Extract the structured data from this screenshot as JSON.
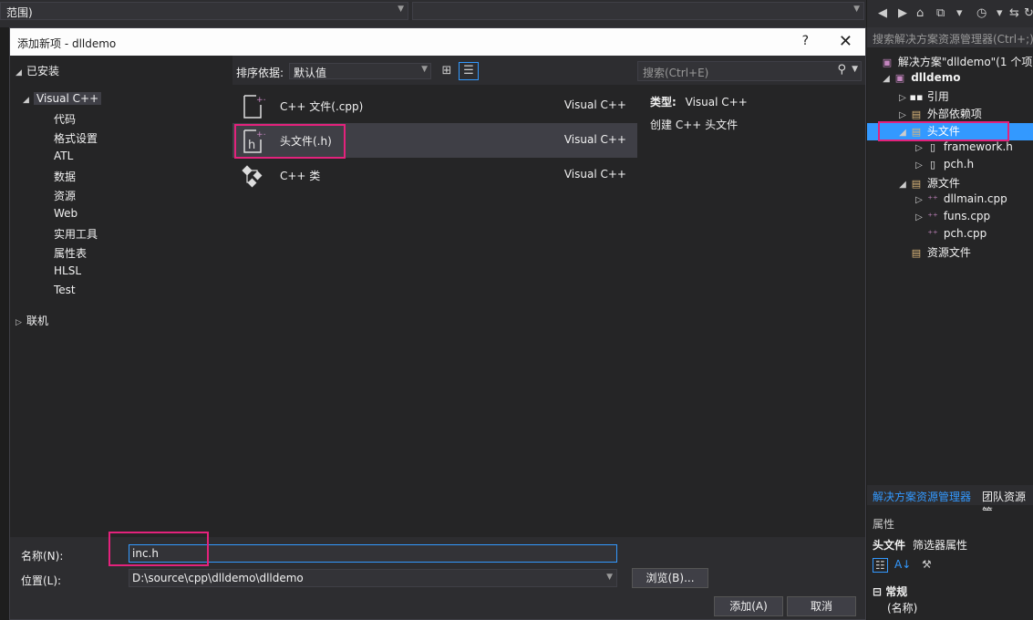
{
  "ide": {
    "scope_combo": "范围)",
    "second_combo": ""
  },
  "dialog": {
    "title": "添加新项 - dlldemo",
    "help": "?",
    "close": "✕"
  },
  "left_tree": {
    "installed": "已安装",
    "visual_cpp": "Visual C++",
    "children": [
      "代码",
      "格式设置",
      "ATL",
      "数据",
      "资源",
      "Web",
      "实用工具",
      "属性表",
      "HLSL",
      "Test"
    ],
    "online": "联机"
  },
  "sortbar": {
    "label": "排序依据:",
    "value": "默认值"
  },
  "search": {
    "placeholder": "搜索(Ctrl+E)"
  },
  "items": [
    {
      "name": "C++ 文件(.cpp)",
      "lang": "Visual C++",
      "icon": "cpp-file-icon"
    },
    {
      "name": "头文件(.h)",
      "lang": "Visual C++",
      "icon": "header-file-icon"
    },
    {
      "name": "C++ 类",
      "lang": "Visual C++",
      "icon": "cpp-class-icon"
    }
  ],
  "details": {
    "type_label": "类型:",
    "type_value": "Visual C++",
    "description": "创建 C++ 头文件"
  },
  "form": {
    "name_label": "名称(N):",
    "name_value": "inc.h",
    "location_label": "位置(L):",
    "location_value": "D:\\source\\cpp\\dlldemo\\dlldemo",
    "browse": "浏览(B)...",
    "add": "添加(A)",
    "cancel": "取消"
  },
  "solution_explorer": {
    "search_placeholder": "搜索解决方案资源管理器(Ctrl+;)",
    "solution": "解决方案\"dlldemo\"(1 个项",
    "project": "dlldemo",
    "nodes": {
      "references": "引用",
      "external_deps": "外部依赖项",
      "header_files": "头文件",
      "framework_h": "framework.h",
      "pch_h": "pch.h",
      "source_files": "源文件",
      "dllmain_cpp": "dllmain.cpp",
      "funs_cpp": "funs.cpp",
      "pch_cpp": "pch.cpp",
      "resource_files": "资源文件"
    },
    "tab_active": "解决方案资源管理器",
    "tab_other": "团队资源管"
  },
  "properties": {
    "title": "属性",
    "object": "头文件",
    "object_type": "筛选器属性",
    "section": "常规",
    "row1": "(名称)"
  },
  "colors": {
    "accent": "#3399ff",
    "highlight": "#e3227c",
    "background": "#2d2d30"
  }
}
